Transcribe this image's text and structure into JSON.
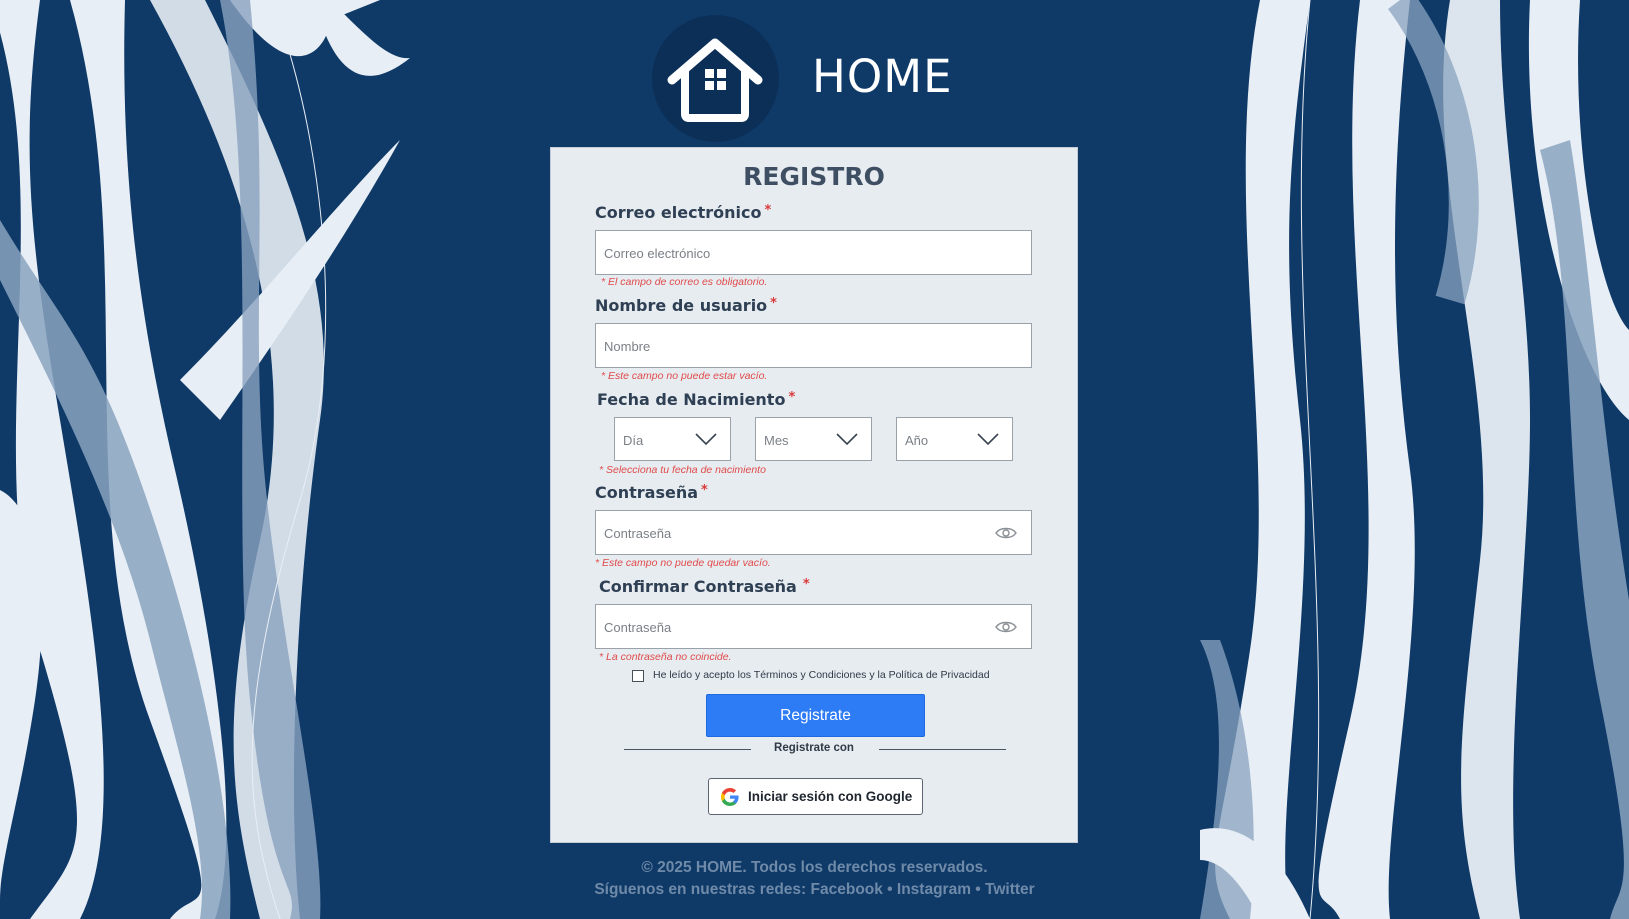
{
  "brand": {
    "name": "HOME",
    "logo_icon": "house-icon"
  },
  "form": {
    "title": "REGISTRO",
    "email": {
      "label": "Correo electrónico",
      "placeholder": "Correo electrónico",
      "error": "* El campo de correo es obligatorio."
    },
    "username": {
      "label": "Nombre de usuario",
      "placeholder": "Nombre",
      "error": "* Este campo no puede estar vacío."
    },
    "birthdate": {
      "label": "Fecha de Nacimiento",
      "day": "Día",
      "month": "Mes",
      "year": "Año",
      "error": "* Selecciona tu fecha de nacimiento"
    },
    "password": {
      "label": "Contraseña",
      "placeholder": "Contraseña",
      "error": "* Este campo no puede quedar vacío."
    },
    "confirm_password": {
      "label": "Confirmar Contraseña",
      "placeholder": "Contraseña",
      "error": "* La contraseña no coincide."
    },
    "required_mark": "*",
    "terms": {
      "text": "He leído y acepto los Términos y Condiciones y la Política de Privacidad",
      "checked": false
    },
    "submit_label": "Registrate",
    "divider_label": "Registrate con",
    "google_label": "Iniciar sesión con Google"
  },
  "footer": {
    "copyright": "© 2025 HOME. Todos los derechos reservados.",
    "social": "Síguenos en nuestras redes: Facebook • Instagram • Twitter"
  },
  "colors": {
    "background": "#0f3a68",
    "card": "#e7ecf1",
    "primary": "#2d7cf6",
    "error": "#e04a4a",
    "required": "#d93a3a"
  }
}
